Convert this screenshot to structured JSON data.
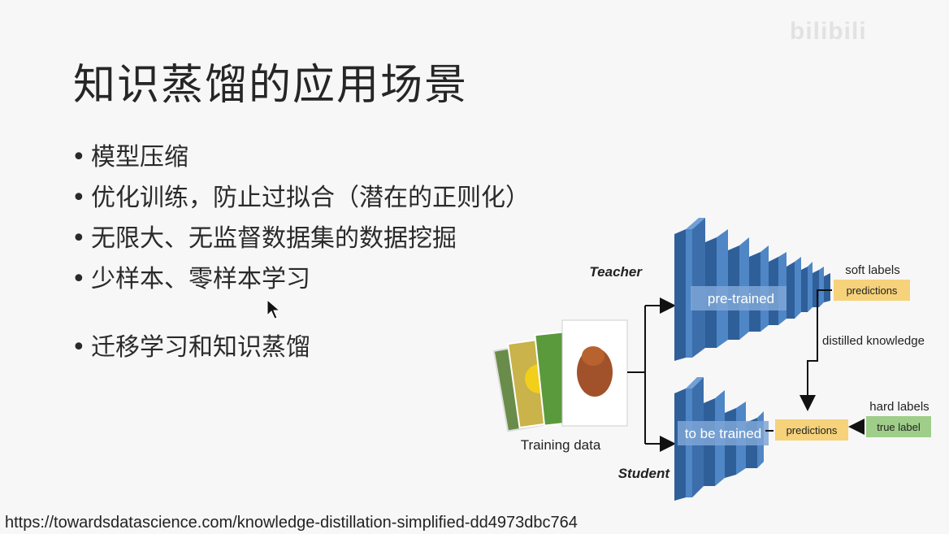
{
  "slide": {
    "title": "知识蒸馏的应用场景",
    "bullets": [
      "模型压缩",
      "优化训练，防止过拟合（潜在的正则化）",
      "无限大、无监督数据集的数据挖掘",
      "少样本、零样本学习",
      "迁移学习和知识蒸馏"
    ],
    "bullet_symbol": "•",
    "source_url": "https://towardsdatascience.com/knowledge-distillation-simplified-dd4973dbc764"
  },
  "diagram": {
    "training_data_label": "Training data",
    "teacher_label": "Teacher",
    "student_label": "Student",
    "teacher_box_label": "pre-trained",
    "student_box_label": "to be trained",
    "soft_labels_label": "soft labels",
    "teacher_predictions_label": "predictions",
    "distilled_label": "distilled  knowledge",
    "student_predictions_label": "predictions",
    "hard_labels_label": "hard labels",
    "true_label_label": "true label",
    "colors": {
      "network_front": "#4f86c6",
      "network_side": "#2f5f99",
      "network_top": "#6fa0d8",
      "predictions_fill": "#f6d27a",
      "true_label_fill": "#9fce8a"
    }
  },
  "overlay": {
    "watermark_text": "bilibili"
  }
}
